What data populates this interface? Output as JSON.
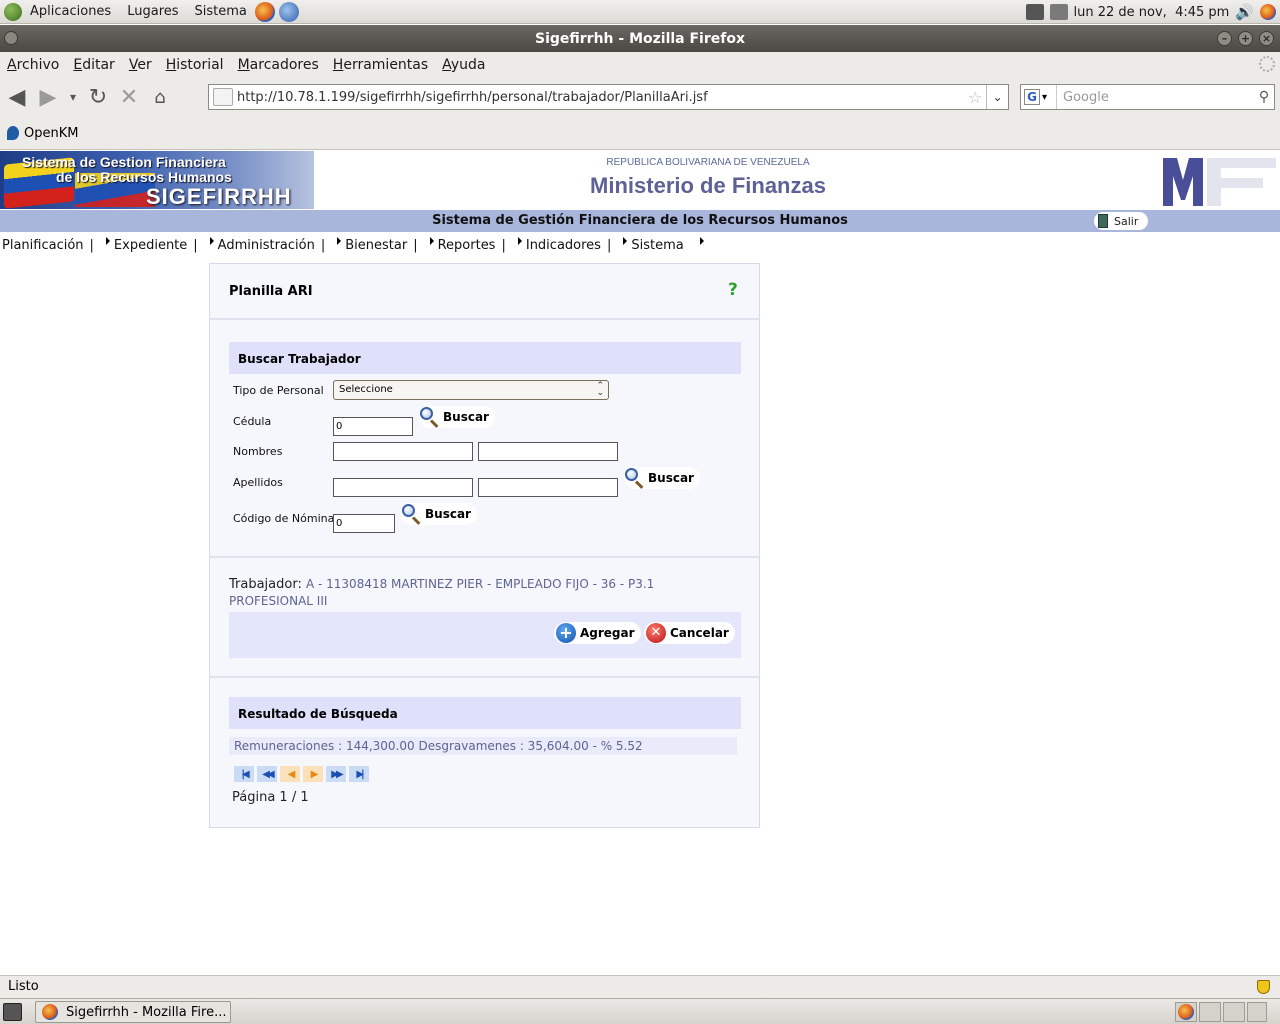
{
  "desktop": {
    "panel_menus": [
      "Aplicaciones",
      "Lugares",
      "Sistema"
    ],
    "clock": "lun 22 de nov,  4:45 pm"
  },
  "window": {
    "title": "Sigefirrhh - Mozilla Firefox"
  },
  "browser": {
    "menu": [
      "Archivo",
      "Editar",
      "Ver",
      "Historial",
      "Marcadores",
      "Herramientas",
      "Ayuda"
    ],
    "url": "http://10.78.1.199/sigefirrhh/sigefirrhh/personal/trabajador/PlanillaAri.jsf",
    "search_placeholder": "Google",
    "search_engine_letter": "G",
    "bookmarks": [
      "OpenKM"
    ],
    "status": "Listo"
  },
  "header": {
    "logo_line1": "Sistema de Gestion Financiera",
    "logo_line2": "de los Recursos Humanos",
    "logo_line3": "SIGEFIRRHH",
    "republic": "REPUBLICA BOLIVARIANA DE VENEZUELA",
    "ministry": "Ministerio de Finanzas",
    "band_title": "Sistema de Gestión Financiera de los Recursos Humanos",
    "logout_label": "Salir"
  },
  "nav": [
    "Planificación",
    "Expediente",
    "Administración",
    "Bienestar",
    "Reportes",
    "Indicadores",
    "Sistema"
  ],
  "form": {
    "title": "Planilla ARI",
    "help": "?",
    "search_section": "Buscar Trabajador",
    "tipo_personal_label": "Tipo de Personal",
    "tipo_personal_value": "Seleccione",
    "cedula_label": "Cédula",
    "cedula_value": "0",
    "nombres_label": "Nombres",
    "apellidos_label": "Apellidos",
    "codigo_nomina_label": "Código de Nómina",
    "codigo_nomina_value": "0",
    "search_button": "Buscar",
    "worker_label": "Trabajador:",
    "worker_value": "A - 11308418 MARTINEZ PIER - EMPLEADO FIJO - 36 - P3.1 PROFESIONAL III",
    "add_button": "Agregar",
    "cancel_button": "Cancelar",
    "results_section": "Resultado de Búsqueda",
    "result_text": "Remuneraciones : 144,300.00 Desgravamenes : 35,604.00 - % 5.52",
    "page_info": "Página 1 / 1"
  },
  "taskbar": {
    "task_label": "Sigefirrhh - Mozilla Fire..."
  },
  "colors": {
    "band": "#a8b6dc",
    "section_header": "#dfe1fa",
    "panel_bg": "#f6f7fd",
    "ministry_text": "#5d6196"
  }
}
